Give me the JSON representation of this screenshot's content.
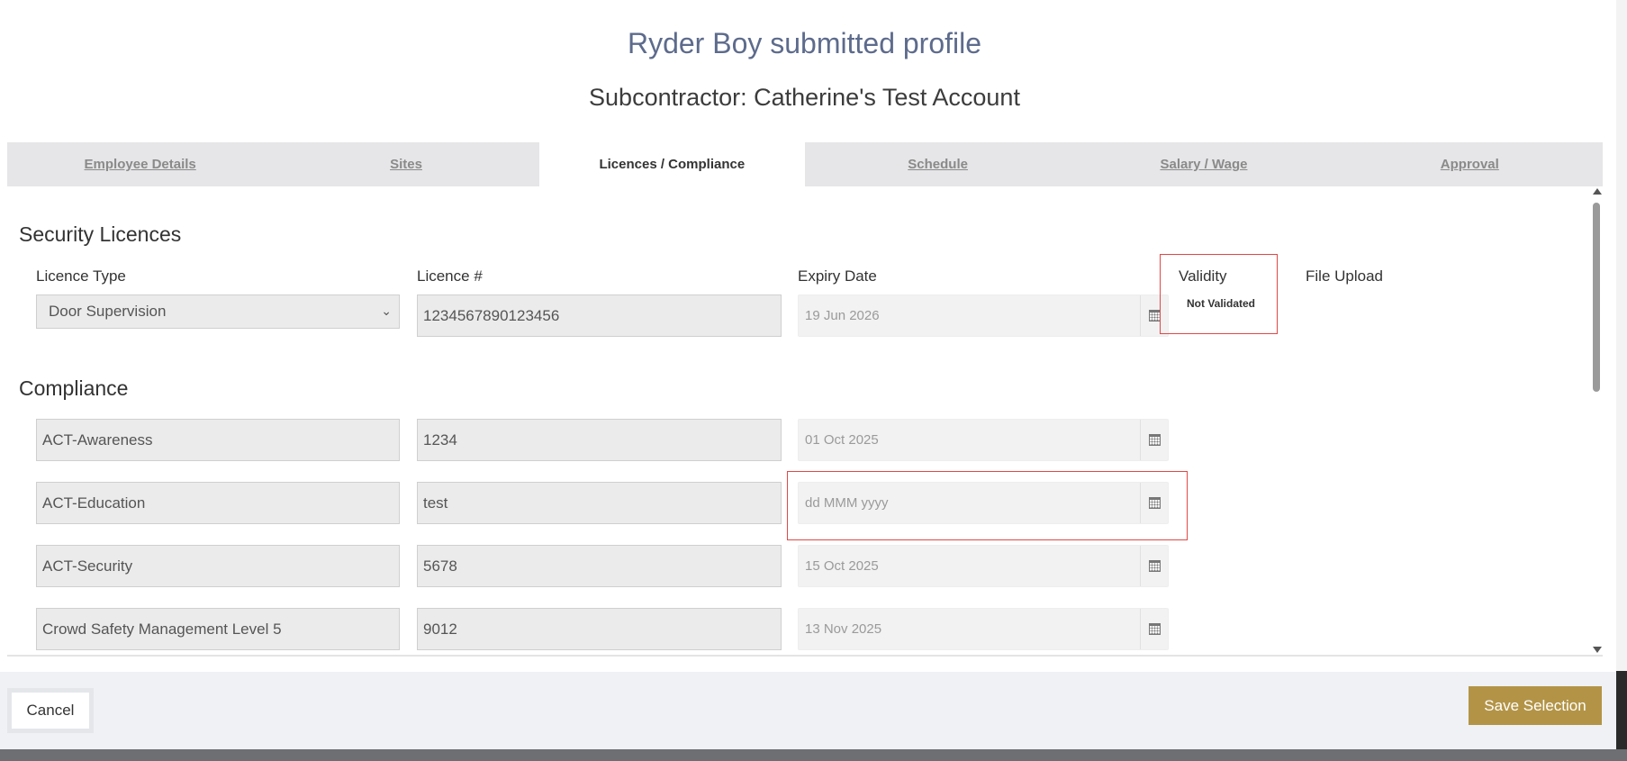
{
  "modal": {
    "title": "Ryder Boy submitted profile",
    "subtitle": "Subcontractor: Catherine's Test Account"
  },
  "tabs": [
    {
      "label": "Employee Details",
      "active": false
    },
    {
      "label": "Sites",
      "active": false
    },
    {
      "label": "Licences / Compliance",
      "active": true
    },
    {
      "label": "Schedule",
      "active": false
    },
    {
      "label": "Salary / Wage",
      "active": false
    },
    {
      "label": "Approval",
      "active": false
    }
  ],
  "security_licences": {
    "heading": "Security Licences",
    "columns": {
      "licence_type": "Licence Type",
      "licence_number": "Licence #",
      "expiry_date": "Expiry Date",
      "validity": "Validity",
      "file_upload": "File Upload"
    },
    "licence_type_value": "Door Supervision",
    "licence_number_value": "1234567890123456",
    "expiry_date_value": "19 Jun 2026",
    "validity_status": "Not Validated"
  },
  "compliance": {
    "heading": "Compliance",
    "rows": [
      {
        "name": "ACT-Awareness",
        "number": "1234",
        "date": "01 Oct 2025"
      },
      {
        "name": "ACT-Education",
        "number": "test",
        "date": "",
        "date_placeholder": "dd MMM yyyy"
      },
      {
        "name": "ACT-Security",
        "number": "5678",
        "date": "15 Oct 2025"
      },
      {
        "name": "Crowd Safety Management Level 5",
        "number": "9012",
        "date": "13 Nov 2025"
      }
    ]
  },
  "footer": {
    "cancel_label": "Cancel",
    "save_label": "Save Selection"
  },
  "colors": {
    "title": "#5d6b8c",
    "save_button": "#b39447",
    "highlight_border": "#e04848"
  }
}
